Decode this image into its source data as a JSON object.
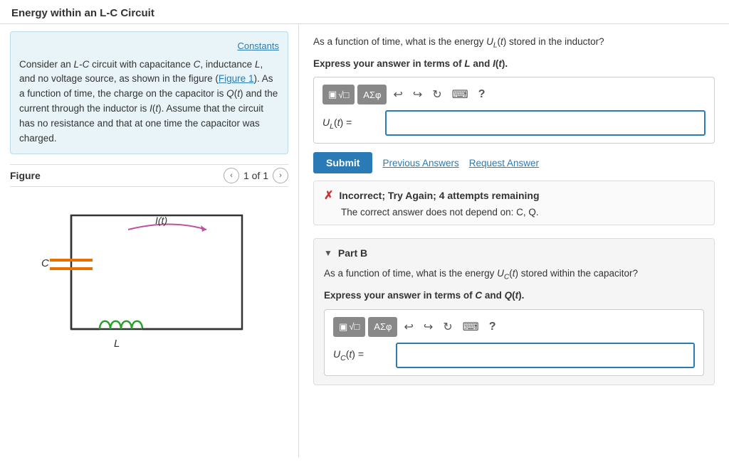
{
  "page": {
    "title": "Energy within an L-C Circuit"
  },
  "left": {
    "constants_link": "Constants",
    "problem_text_parts": [
      "Consider an L-C circuit with capacitance C, inductance L, and no voltage source, as shown in the figure (Figure 1). As a function of time, the charge on the capacitor is Q(t) and the current through the inductor is I(t). Assume that the circuit has no resistance and that at one time the capacitor was charged."
    ],
    "figure_label": "Figure",
    "figure_nav": "1 of 1"
  },
  "right": {
    "part_a": {
      "question_line1": "As a function of time, what is the energy",
      "energy_symbol": "U",
      "subscript_L": "L",
      "question_line2": "(t) stored in the inductor?",
      "instruction": "Express your answer in terms of L and I(t).",
      "formula_label": "U",
      "formula_subscript": "L",
      "formula_suffix": "(t) =",
      "input_placeholder": "",
      "toolbar": {
        "btn1_label": "▣√□",
        "btn2_label": "ΑΣφ",
        "undo_icon": "↩",
        "redo_icon": "↪",
        "refresh_icon": "↻",
        "keyboard_icon": "⌨",
        "help_icon": "?"
      },
      "submit_label": "Submit",
      "prev_answers_label": "Previous Answers",
      "request_answer_label": "Request Answer",
      "feedback": {
        "status": "incorrect",
        "title": "Incorrect; Try Again; 4 attempts remaining",
        "detail": "The correct answer does not depend on: C, Q."
      }
    },
    "part_b": {
      "label": "Part B",
      "question_line1": "As a function of time, what is the energy",
      "energy_symbol": "U",
      "subscript_C": "C",
      "question_line2": "(t) stored within the capacitor?",
      "instruction": "Express your answer in terms of C and Q(t).",
      "formula_label": "U",
      "formula_subscript": "C",
      "formula_suffix": "(t) =",
      "input_placeholder": "",
      "toolbar": {
        "btn1_label": "▣√□",
        "btn2_label": "ΑΣφ",
        "undo_icon": "↩",
        "redo_icon": "↪",
        "refresh_icon": "↻",
        "keyboard_icon": "⌨",
        "help_icon": "?"
      }
    }
  }
}
